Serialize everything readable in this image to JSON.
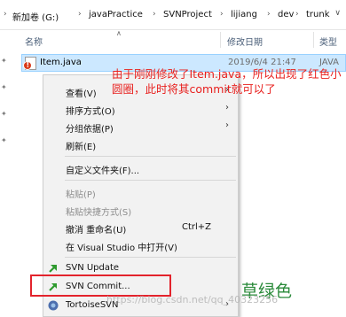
{
  "breadcrumb": {
    "items": [
      "新加卷 (G:)",
      "javaPractice",
      "SVNProject",
      "lijiang",
      "dev",
      "trunk"
    ],
    "separator": "›"
  },
  "columns": {
    "name": "名称",
    "date": "修改日期",
    "type": "类型"
  },
  "file": {
    "name": "Item.java",
    "date": "2019/6/4 21:47",
    "type": "JAVA",
    "badge_color": "#d93a1b"
  },
  "annotation": {
    "text": "由于刚刚修改了Item.java，所以出现了红色小圆圈，此时将其commit就可以了",
    "color": "#e8201e"
  },
  "menu": {
    "view": "查看(V)",
    "sort": "排序方式(O)",
    "group": "分组依据(P)",
    "refresh": "刷新(E)",
    "customize": "自定义文件夹(F)...",
    "paste": "粘贴(P)",
    "paste_shortcut": "粘贴快捷方式(S)",
    "undo_rename": "撤消 重命名(U)",
    "undo_shortcut": "Ctrl+Z",
    "open_vs": "在 Visual Studio 中打开(V)",
    "svn_update": "SVN Update",
    "svn_commit": "SVN Commit...",
    "tortoise": "TortoiseSVN"
  },
  "green_label": {
    "text": "草绿色",
    "color": "#2a8a3a"
  },
  "watermark": "https://blog.csdn.net/qq_40323256",
  "highlight_color": "#e3232c"
}
